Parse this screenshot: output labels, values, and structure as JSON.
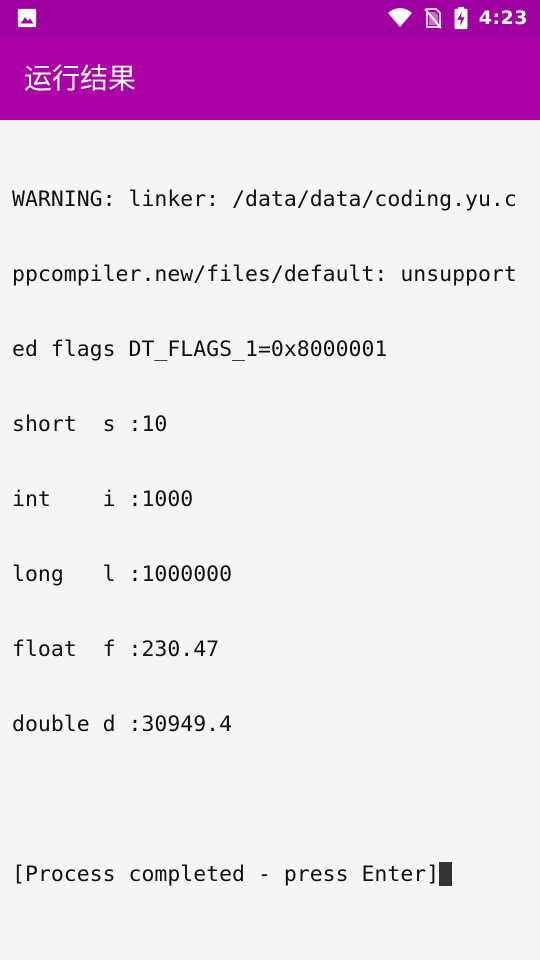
{
  "status_bar": {
    "time": "4:23",
    "icons": [
      "gallery-icon",
      "wifi-icon",
      "no-sim-icon",
      "battery-charging-icon"
    ]
  },
  "toolbar": {
    "title": "运行结果"
  },
  "terminal": {
    "lines": [
      "WARNING: linker: /data/data/coding.yu.c",
      "ppcompiler.new/files/default: unsupport",
      "ed flags DT_FLAGS_1=0x8000001",
      "short  s :10",
      "int    i :1000",
      "long   l :1000000",
      "float  f :230.47",
      "double d :30949.4",
      "",
      "[Process completed - press Enter]"
    ]
  },
  "colors": {
    "status_bar": "#a000a0",
    "toolbar": "#aa00a5",
    "background": "#f5f5f5",
    "text": "#111111",
    "cursor": "#333333"
  }
}
